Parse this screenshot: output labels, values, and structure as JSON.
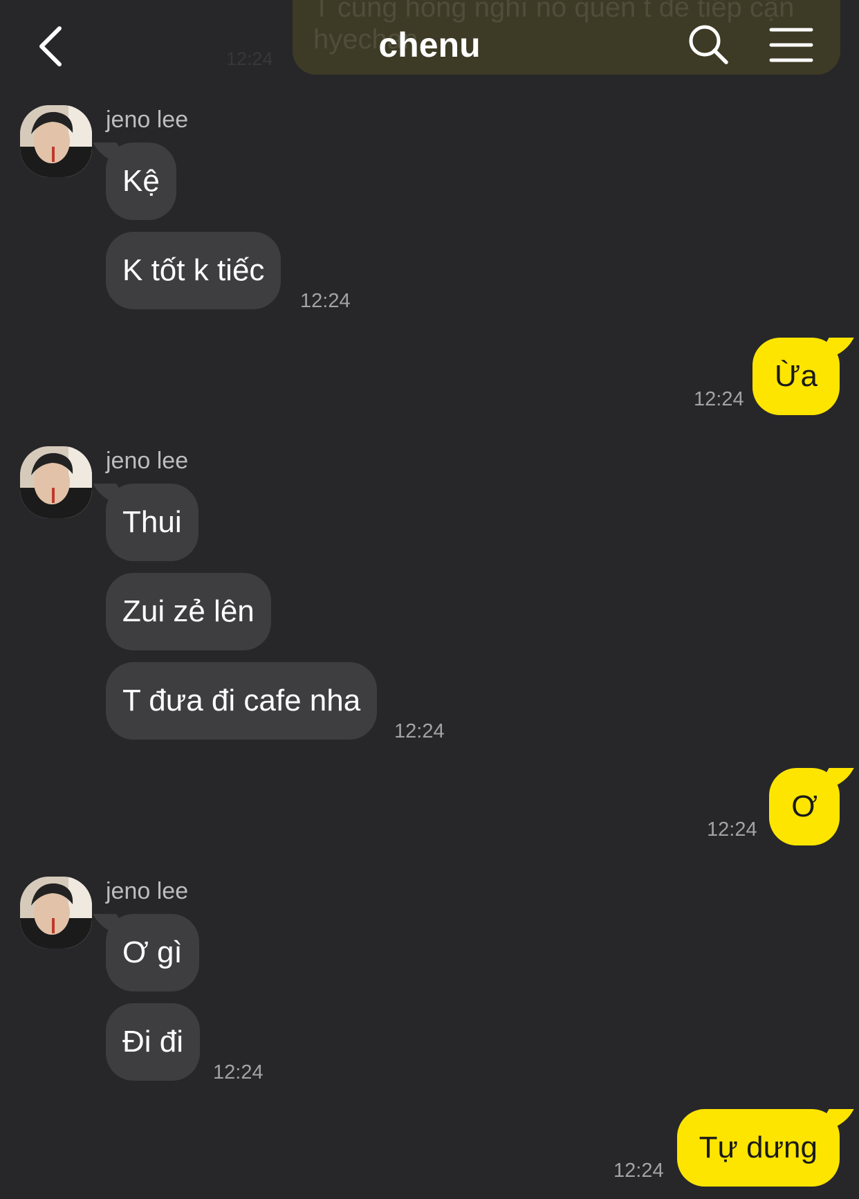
{
  "header": {
    "title": "chenu",
    "back_icon": "chevron-left-icon",
    "search_icon": "search-icon",
    "menu_icon": "hamburger-menu-icon"
  },
  "peek": {
    "text": "T cũng hông nghĩ nó quen t để tiếp cận hyechan",
    "time": "12:24"
  },
  "colors": {
    "background": "#27272a",
    "incoming_bubble": "#3e3e40",
    "outgoing_bubble": "#fee500",
    "timestamp": "#a3a3a3"
  },
  "groups": [
    {
      "sender": "jeno lee",
      "messages": [
        "Kệ",
        "K tốt k tiếc"
      ],
      "time": "12:24"
    },
    {
      "mine": "Ừa",
      "time": "12:24"
    },
    {
      "sender": "jeno lee",
      "messages": [
        "Thui",
        "Zui zẻ lên",
        "T đưa đi cafe nha"
      ],
      "time": "12:24"
    },
    {
      "mine": "Ơ",
      "time": "12:24"
    },
    {
      "sender": "jeno lee",
      "messages": [
        "Ơ gì",
        "Đi đi"
      ],
      "time": "12:24"
    },
    {
      "mine": "Tự dưng",
      "time": "12:24"
    }
  ]
}
